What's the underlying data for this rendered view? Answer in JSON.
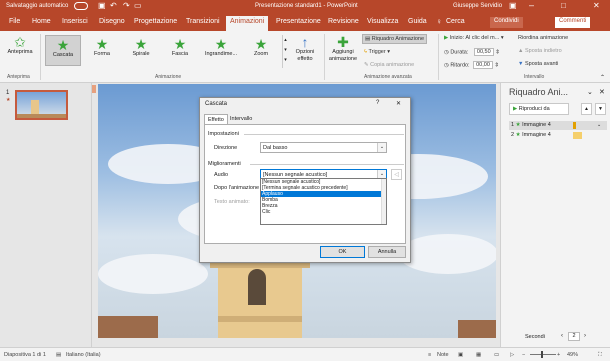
{
  "titlebar": {
    "autosave": "Salvataggio automatico",
    "autosave_state": "",
    "title": "Presentazione standard1 - PowerPoint",
    "user": "Giuseppe Servidio"
  },
  "tabs": [
    "File",
    "Home",
    "Inserisci",
    "Disegno",
    "Progettazione",
    "Transizioni",
    "Animazioni",
    "Presentazione",
    "Revisione",
    "Visualizza",
    "Guida",
    "Cerca"
  ],
  "active_tab": "Animazioni",
  "share": {
    "condividi": "Condividi",
    "commenti": "Commenti"
  },
  "ribbon": {
    "anteprima": "Anteprima",
    "anteprima_group": "Anteprima",
    "animations": [
      "Cascata",
      "Forma",
      "Spirale",
      "Fascia",
      "Ingrandime...",
      "Zoom"
    ],
    "opzioni_effetto": "Opzioni effetto",
    "animazione_group": "Animazione",
    "aggiungi_animazione": "Aggiungi animazione",
    "riquadro_animazione": "Riquadro Animazione",
    "trigger": "Trigger",
    "copia_animazione": "Copia animazione",
    "animazione_avanzata_group": "Animazione avanzata",
    "inizio_label": "Inizio:",
    "inizio_value": "Al clic del m...",
    "durata_label": "Durata:",
    "durata_value": "00,50",
    "ritardo_label": "Ritardo:",
    "ritardo_value": "00,00",
    "riordina": "Riordina animazione",
    "sposta_indietro": "Sposta indietro",
    "sposta_avanti": "Sposta avanti",
    "intervallo_group": "Intervallo"
  },
  "slide_panel": {
    "slide_number": "1"
  },
  "dialog": {
    "title": "Cascata",
    "help": "?",
    "close": "✕",
    "tabs": [
      "Effetto",
      "Intervallo"
    ],
    "impostazioni": "Impostazioni",
    "direzione_label": "Direzione",
    "direzione_value": "Dal basso",
    "miglioramenti": "Miglioramenti",
    "audio_label": "Audio",
    "audio_value": "[Nessun segnale acustico]",
    "dopo_label": "Dopo l'animazione",
    "testo_label": "Testo animato:",
    "list_items": [
      "[Nessun segnale acustico]",
      "[Termina segnale acustico precedente]",
      "Applauso",
      "Bomba",
      "Brezza",
      "Clic"
    ],
    "selected_item": "Applauso",
    "ok": "OK",
    "annulla": "Annulla"
  },
  "right_panel": {
    "title": "Riquadro Ani...",
    "riproduci": "Riproduci da",
    "items": [
      {
        "num": "1",
        "label": "Immagine 4"
      },
      {
        "num": "2",
        "label": "Immagine 4"
      }
    ],
    "secondi": "Secondi",
    "page": "2"
  },
  "status": {
    "slide": "Diapositiva 1 di 1",
    "lang": "Italiano (Italia)",
    "note": "Note",
    "zoom": "49%"
  },
  "colors": {
    "accent": "#b7472a",
    "select": "#0078d7",
    "star": "#3aa43a"
  }
}
